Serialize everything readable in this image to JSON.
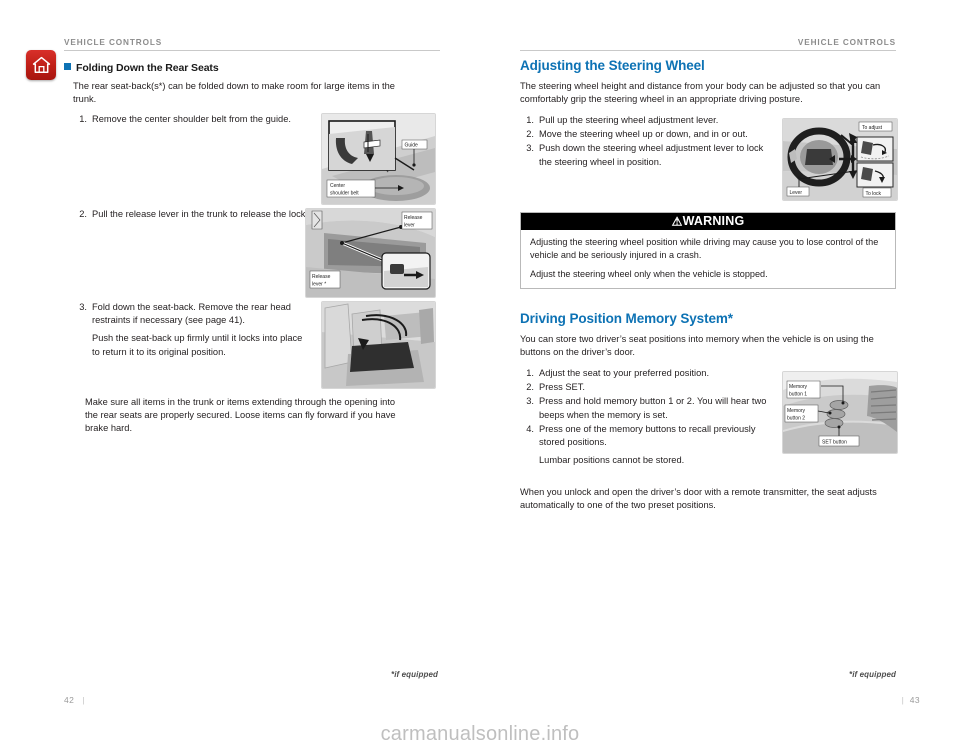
{
  "document": {
    "watermark": "carmanualsonline.info"
  },
  "left_page": {
    "running_head": "VEHICLE CONTROLS",
    "home_icon": "home-icon",
    "section_heading": "Folding Down the Rear Seats",
    "intro": "The rear seat-back(s*) can be folded down to make room for large items in the trunk.",
    "steps": [
      {
        "number": "1.",
        "text": "Remove the center shoulder belt from the guide."
      },
      {
        "number": "2.",
        "text": "Pull the release lever in the trunk to release the lock."
      },
      {
        "number": "3.",
        "text": "Fold down the seat-back. Remove the rear head restraints if necessary (see page 41).",
        "sub": "Push the seat-back up firmly until it locks into place to return it to its original position."
      }
    ],
    "closing_note": "Make sure all items in the trunk or items extending through the opening into the rear seats are properly secured. Loose items can fly forward if you have brake hard.",
    "figures": [
      {
        "name": "figure-shoulder-belt-guide",
        "labels": [
          "Guide",
          "Center",
          "shoulder belt"
        ]
      },
      {
        "name": "figure-trunk-release-lever",
        "labels": [
          "Release",
          "lever",
          "Release",
          "lever *"
        ]
      },
      {
        "name": "figure-fold-seat-back",
        "labels": []
      }
    ],
    "if_equipped": "*if equipped",
    "page_number": "42"
  },
  "right_page": {
    "running_head": "VEHICLE CONTROLS",
    "heading_steering": "Adjusting the Steering Wheel",
    "intro_steering": "The steering wheel height and distance from your body can be adjusted so that you can comfortably grip the steering wheel in an appropriate driving posture.",
    "steps_steering": [
      {
        "number": "1.",
        "text": "Pull up the steering wheel adjustment lever."
      },
      {
        "number": "2.",
        "text": "Move the steering wheel up or down, and in or out."
      },
      {
        "number": "3.",
        "text": "Push down the steering wheel adjustment lever to lock the steering wheel in position."
      }
    ],
    "warning": {
      "title": "WARNING",
      "triangle": "⚠",
      "paragraphs": [
        "Adjusting the steering wheel position while driving may cause you to lose control of the vehicle and be seriously injured in a crash.",
        "Adjust the steering wheel only when the vehicle is stopped."
      ]
    },
    "heading_memory": "Driving Position Memory System*",
    "intro_memory": "You can store two driver’s seat positions into memory when the vehicle is on using the buttons on the driver’s door.",
    "steps_memory": [
      {
        "number": "1.",
        "text": "Adjust the seat to your preferred position."
      },
      {
        "number": "2.",
        "text": "Press SET."
      },
      {
        "number": "3.",
        "text": "Press and hold memory button 1 or 2. You will hear two beeps when the memory is set."
      },
      {
        "number": "4.",
        "text": "Press one of the memory buttons to recall previously stored positions.",
        "sub": "Lumbar positions cannot be stored."
      }
    ],
    "closing_note": "When you unlock and open the driver’s door with a remote transmitter, the seat adjusts automatically to one of the two preset positions.",
    "figures": [
      {
        "name": "figure-steering-wheel-adjust",
        "labels": [
          "To adjust",
          "Lever",
          "To lock"
        ]
      },
      {
        "name": "figure-memory-buttons",
        "labels": [
          "Memory",
          "button 1",
          "Memory",
          "button 2",
          "SET button"
        ]
      }
    ],
    "if_equipped": "*if equipped",
    "page_number": "43"
  },
  "colors": {
    "accent_blue": "#0d72b4",
    "icon_red": "#c01f17",
    "warning_bar": "#000000",
    "rule": "#c9c9c9"
  }
}
